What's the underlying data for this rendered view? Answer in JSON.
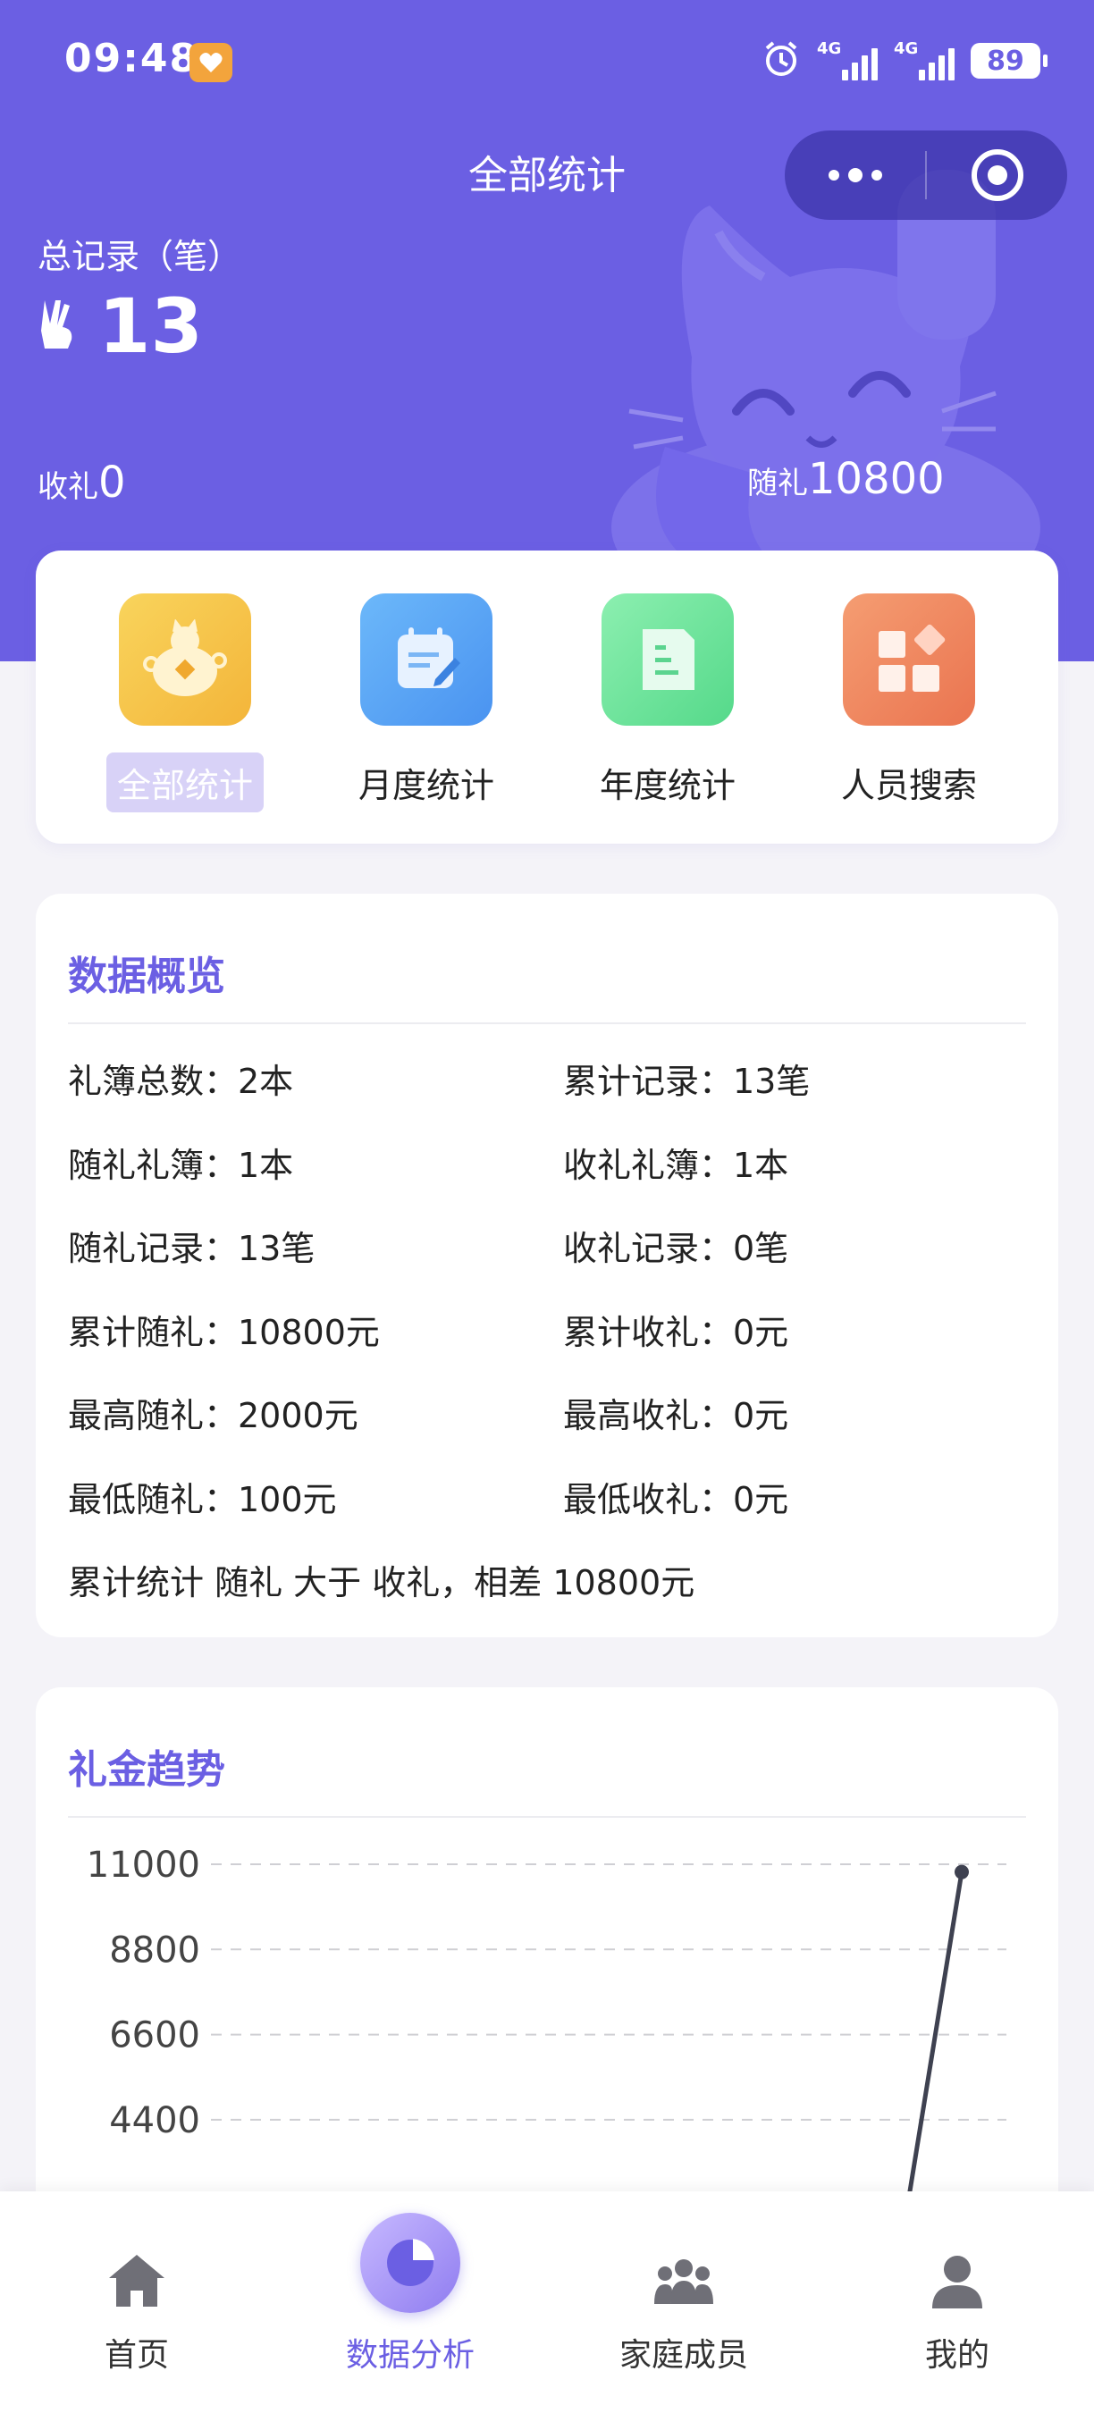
{
  "status_bar": {
    "time": "09:48",
    "signal1": "4G",
    "signal2": "4G",
    "battery": "89"
  },
  "header": {
    "title": "全部统计"
  },
  "summary": {
    "total_label": "总记录（笔）",
    "total_count": "13",
    "received_label": "收礼",
    "received_value": "0",
    "given_label": "随礼",
    "given_value": "10800"
  },
  "menu": [
    {
      "label": "全部统计",
      "icon": "money-bag-icon",
      "color": "#f5c64a",
      "active": true
    },
    {
      "label": "月度统计",
      "icon": "calendar-note-icon",
      "color": "#5aa9f5",
      "active": false
    },
    {
      "label": "年度统计",
      "icon": "document-icon",
      "color": "#6ee39a",
      "active": false
    },
    {
      "label": "人员搜索",
      "icon": "grid-apps-icon",
      "color": "#f08a64",
      "active": false
    }
  ],
  "overview": {
    "title": "数据概览",
    "rows": [
      [
        "礼簿总数：2本",
        "累计记录：13笔"
      ],
      [
        "随礼礼簿：1本",
        "收礼礼簿：1本"
      ],
      [
        "随礼记录：13笔",
        "收礼记录：0笔"
      ],
      [
        "累计随礼：10800元",
        "累计收礼：0元"
      ],
      [
        "最高随礼：2000元",
        "最高收礼：0元"
      ],
      [
        "最低随礼：100元",
        "最低收礼：0元"
      ]
    ],
    "summary": "累计统计 随礼 大于 收礼，相差 10800元"
  },
  "trend": {
    "title": "礼金趋势",
    "chart_data": {
      "type": "line",
      "y_ticks": [
        "11000",
        "8800",
        "6600",
        "4400"
      ],
      "ylim": [
        0,
        11000
      ],
      "grid": true,
      "series": [
        {
          "values": [
            10800
          ],
          "partial_visible_segment": true
        }
      ]
    }
  },
  "tabbar": [
    {
      "label": "首页",
      "icon": "home-icon",
      "active": false
    },
    {
      "label": "数据分析",
      "icon": "pie-chart-icon",
      "active": true
    },
    {
      "label": "家庭成员",
      "icon": "family-icon",
      "active": false
    },
    {
      "label": "我的",
      "icon": "user-icon",
      "active": false
    }
  ],
  "colors": {
    "accent": "#6b5fe3",
    "background": "#f4f3f8"
  }
}
